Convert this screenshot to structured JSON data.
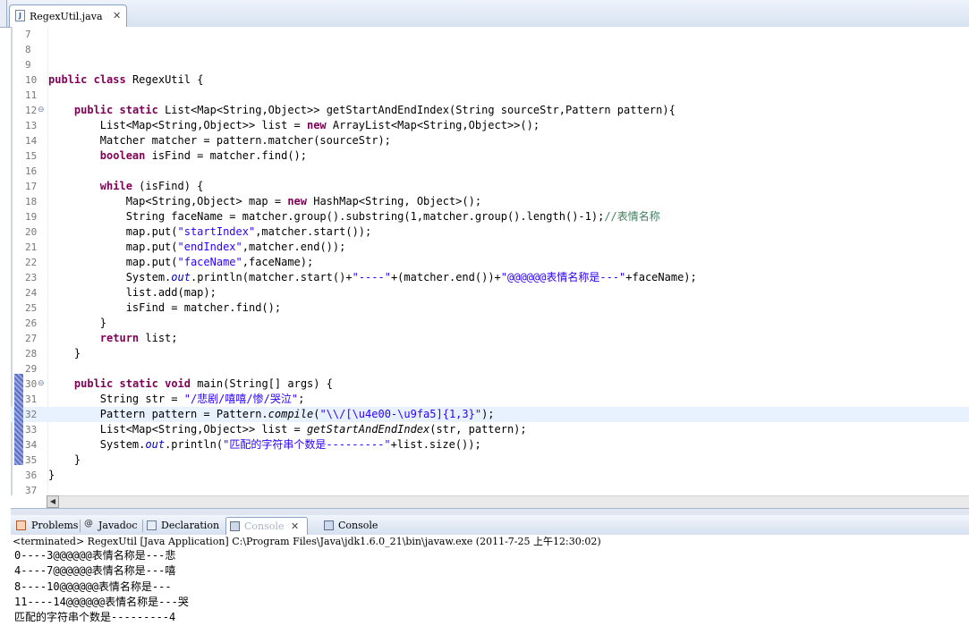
{
  "editor": {
    "tab_label": "RegexUtil.java",
    "lines": [
      {
        "n": "7",
        "segs": []
      },
      {
        "n": "8",
        "segs": []
      },
      {
        "n": "9",
        "segs": []
      },
      {
        "n": "10",
        "segs": [
          [
            "kw",
            "public"
          ],
          [
            "t",
            " "
          ],
          [
            "kw",
            "class"
          ],
          [
            "t",
            " RegexUtil {"
          ]
        ]
      },
      {
        "n": "11",
        "segs": []
      },
      {
        "n": "12",
        "fold": true,
        "segs": [
          [
            "t",
            "    "
          ],
          [
            "kw",
            "public"
          ],
          [
            "t",
            " "
          ],
          [
            "kw",
            "static"
          ],
          [
            "t",
            " List<Map<String,Object>> getStartAndEndIndex(String sourceStr,Pattern pattern){"
          ]
        ]
      },
      {
        "n": "13",
        "segs": [
          [
            "t",
            "        List<Map<String,Object>> list = "
          ],
          [
            "kw",
            "new"
          ],
          [
            "t",
            " ArrayList<Map<String,Object>>();"
          ]
        ]
      },
      {
        "n": "14",
        "segs": [
          [
            "t",
            "        Matcher matcher = pattern.matcher(sourceStr);"
          ]
        ]
      },
      {
        "n": "15",
        "segs": [
          [
            "t",
            "        "
          ],
          [
            "kw",
            "boolean"
          ],
          [
            "t",
            " isFind = matcher.find();"
          ]
        ]
      },
      {
        "n": "16",
        "segs": []
      },
      {
        "n": "17",
        "segs": [
          [
            "t",
            "        "
          ],
          [
            "kw",
            "while"
          ],
          [
            "t",
            " (isFind) {"
          ]
        ]
      },
      {
        "n": "18",
        "segs": [
          [
            "t",
            "            Map<String,Object> map = "
          ],
          [
            "kw",
            "new"
          ],
          [
            "t",
            " HashMap<String, Object>();"
          ]
        ]
      },
      {
        "n": "19",
        "segs": [
          [
            "t",
            "            String faceName = matcher.group().substring(1,matcher.group().length()-1);"
          ],
          [
            "cm",
            "//表情名称"
          ]
        ]
      },
      {
        "n": "20",
        "segs": [
          [
            "t",
            "            map.put("
          ],
          [
            "str",
            "\"startIndex\""
          ],
          [
            "t",
            ",matcher.start());"
          ]
        ]
      },
      {
        "n": "21",
        "segs": [
          [
            "t",
            "            map.put("
          ],
          [
            "str",
            "\"endIndex\""
          ],
          [
            "t",
            ",matcher.end());"
          ]
        ]
      },
      {
        "n": "22",
        "segs": [
          [
            "t",
            "            map.put("
          ],
          [
            "str",
            "\"faceName\""
          ],
          [
            "t",
            ",faceName);"
          ]
        ]
      },
      {
        "n": "23",
        "segs": [
          [
            "t",
            "            System."
          ],
          [
            "it",
            "out"
          ],
          [
            "t",
            ".println(matcher.start()+"
          ],
          [
            "str",
            "\"----\""
          ],
          [
            "t",
            "+(matcher.end())+"
          ],
          [
            "str",
            "\"@@@@@@表情名称是---\""
          ],
          [
            "t",
            "+faceName);"
          ]
        ]
      },
      {
        "n": "24",
        "segs": [
          [
            "t",
            "            list.add(map);"
          ]
        ]
      },
      {
        "n": "25",
        "segs": [
          [
            "t",
            "            isFind = matcher.find();"
          ]
        ]
      },
      {
        "n": "26",
        "segs": [
          [
            "t",
            "        }"
          ]
        ]
      },
      {
        "n": "27",
        "segs": [
          [
            "t",
            "        "
          ],
          [
            "kw",
            "return"
          ],
          [
            "t",
            " list;"
          ]
        ]
      },
      {
        "n": "28",
        "segs": [
          [
            "t",
            "    }"
          ]
        ]
      },
      {
        "n": "29",
        "segs": []
      },
      {
        "n": "30",
        "fold": true,
        "segs": [
          [
            "t",
            "    "
          ],
          [
            "kw",
            "public"
          ],
          [
            "t",
            " "
          ],
          [
            "kw",
            "static"
          ],
          [
            "t",
            " "
          ],
          [
            "kw",
            "void"
          ],
          [
            "t",
            " main(String[] args) {"
          ]
        ]
      },
      {
        "n": "31",
        "segs": [
          [
            "t",
            "        String str = "
          ],
          [
            "str",
            "\"/悲剧/嘻嘻/惨/哭泣\""
          ],
          [
            "t",
            ";"
          ]
        ]
      },
      {
        "n": "32",
        "current": true,
        "segs": [
          [
            "t",
            "        Pattern pattern = Pattern."
          ],
          [
            "itb",
            "compile"
          ],
          [
            "t",
            "("
          ],
          [
            "str",
            "\"\\\\/[\\u4e00-\\u9fa5]{1,3}\""
          ],
          [
            "t",
            ");"
          ]
        ]
      },
      {
        "n": "33",
        "segs": [
          [
            "t",
            "        List<Map<String,Object>> list = "
          ],
          [
            "itb",
            "getStartAndEndIndex"
          ],
          [
            "t",
            "(str, pattern);"
          ]
        ]
      },
      {
        "n": "34",
        "segs": [
          [
            "t",
            "        System."
          ],
          [
            "it",
            "out"
          ],
          [
            "t",
            ".println("
          ],
          [
            "str",
            "\"匹配的字符串个数是---------\""
          ],
          [
            "t",
            "+list.size());"
          ]
        ]
      },
      {
        "n": "35",
        "segs": [
          [
            "t",
            "    }"
          ]
        ]
      },
      {
        "n": "36",
        "segs": [
          [
            "t",
            "}"
          ]
        ]
      },
      {
        "n": "37",
        "segs": []
      }
    ]
  },
  "views": {
    "problems": "Problems",
    "javadoc": "Javadoc",
    "declaration": "Declaration",
    "console_active": "Console",
    "console": "Console"
  },
  "console": {
    "header": "<terminated> RegexUtil [Java Application] C:\\Program Files\\Java\\jdk1.6.0_21\\bin\\javaw.exe (2011-7-25 上午12:30:02)",
    "output": [
      "0----3@@@@@@表情名称是---悲",
      "4----7@@@@@@表情名称是---嘻",
      "8----10@@@@@@表情名称是---",
      "11----14@@@@@@表情名称是---哭",
      "匹配的字符串个数是---------4"
    ]
  }
}
